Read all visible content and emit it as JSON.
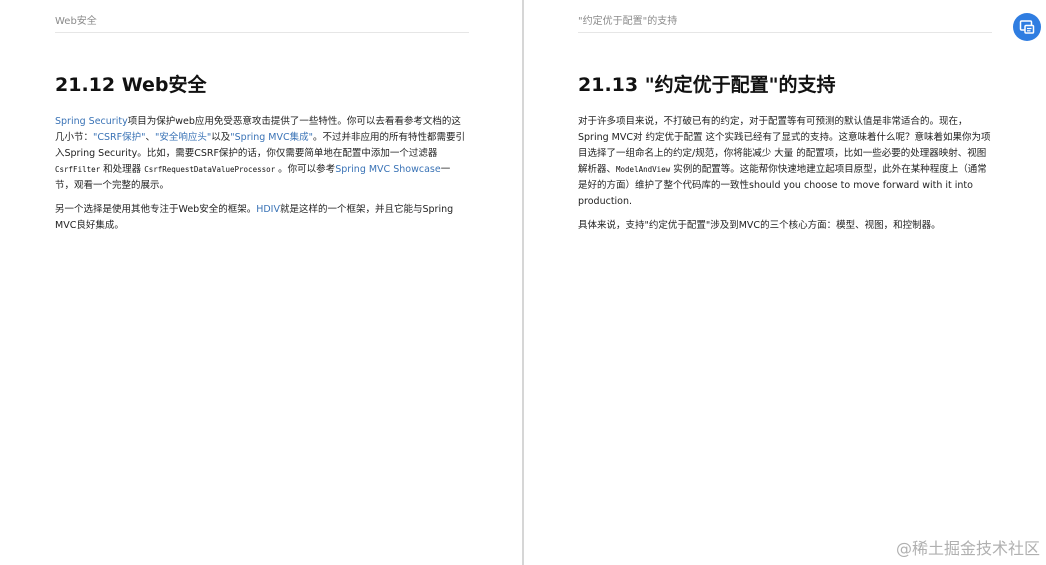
{
  "left_page": {
    "running_header": "Web安全",
    "title": "21.12 Web安全",
    "p1": {
      "link_spring_security": "Spring Security",
      "t1": "项目为保护web应用免受恶意攻击提供了一些特性。你可以去看看参考文档的这几小节：",
      "link_csrf": "\"CSRF保护\"",
      "sep1": "、",
      "link_headers": "\"安全响应头\"",
      "t2": "以及",
      "link_mvc_integration": "\"Spring MVC集成\"",
      "t3": "。不过并非应用的所有特性都需要引入Spring Security。比如，需要CSRF保护的话，你仅需要简单地在配置中添加一个过滤器",
      "code_filter": "CsrfFilter",
      "t4": " 和处理器 ",
      "code_processor": "CsrfRequestDataValueProcessor",
      "t5": " 。你可以参考",
      "link_showcase": "Spring MVC Showcase",
      "t6": "一节，观看一个完整的展示。"
    },
    "p2": {
      "t1": "另一个选择是使用其他专注于Web安全的框架。",
      "link_hdiv": "HDIV",
      "t2": "就是这样的一个框架，并且它能与Spring MVC良好集成。"
    }
  },
  "right_page": {
    "running_header": "\"约定优于配置\"的支持",
    "title": "21.13 \"约定优于配置\"的支持",
    "p1": {
      "t1": "对于许多项目来说，不打破已有的约定，对于配置等有可预测的默认值是非常适合的。现在，Spring MVC对 约定优于配置 这个实践已经有了显式的支持。这意味着什么呢？意味着如果你为项目选择了一组命名上的约定/规范，你将能减少 大量 的配置项，比如一些必要的处理器映射、视图解析器、",
      "code_mav": "ModelAndView",
      "t2": " 实例的配置等。这能帮你快速地建立起项目原型，此外在某种程度上（通常是好的方面）维护了整个代码库的一致性should you choose to move forward with it into production."
    },
    "p2": "具体来说，支持\"约定优于配置\"涉及到MVC的三个核心方面：模型、视图，和控制器。"
  },
  "overlay": {
    "button_icon": "chat-window-icon",
    "watermark": "@稀土掘金技术社区"
  },
  "colors": {
    "link": "#3a73b6",
    "button": "#2f7de1"
  }
}
